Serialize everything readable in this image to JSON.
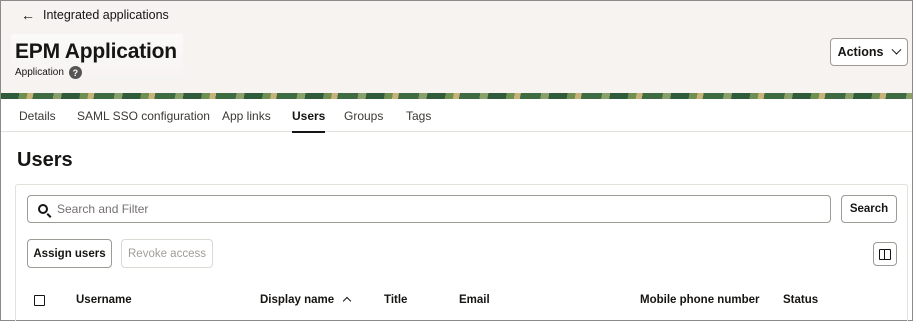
{
  "header": {
    "back_label": "Integrated applications",
    "title": "EPM Application",
    "subtitle": "Application",
    "help_glyph": "?",
    "actions_label": "Actions"
  },
  "tabs": [
    {
      "label": "Details",
      "active": false
    },
    {
      "label": "SAML SSO configuration",
      "active": false
    },
    {
      "label": "App links",
      "active": false
    },
    {
      "label": "Users",
      "active": true
    },
    {
      "label": "Groups",
      "active": false
    },
    {
      "label": "Tags",
      "active": false
    }
  ],
  "section": {
    "title": "Users"
  },
  "search": {
    "placeholder": "Search and Filter",
    "button_label": "Search"
  },
  "toolbar": {
    "assign_label": "Assign users",
    "revoke_label": "Revoke access"
  },
  "table": {
    "columns": [
      "Username",
      "Display name",
      "Title",
      "Email",
      "Mobile phone number",
      "Status"
    ],
    "sorted_column": "Display name",
    "sort_direction": "ascending"
  },
  "icons": {
    "back": "arrow-left-icon",
    "help": "help-icon",
    "actions": "chevron-down-icon",
    "search": "search-icon",
    "columns": "columns-icon",
    "sort": "sort-ascending-icon"
  },
  "colors": {
    "header_bg": "#f6f3f1",
    "text": "#161513",
    "border": "#9e9a96",
    "disabled_text": "#a09c98"
  }
}
